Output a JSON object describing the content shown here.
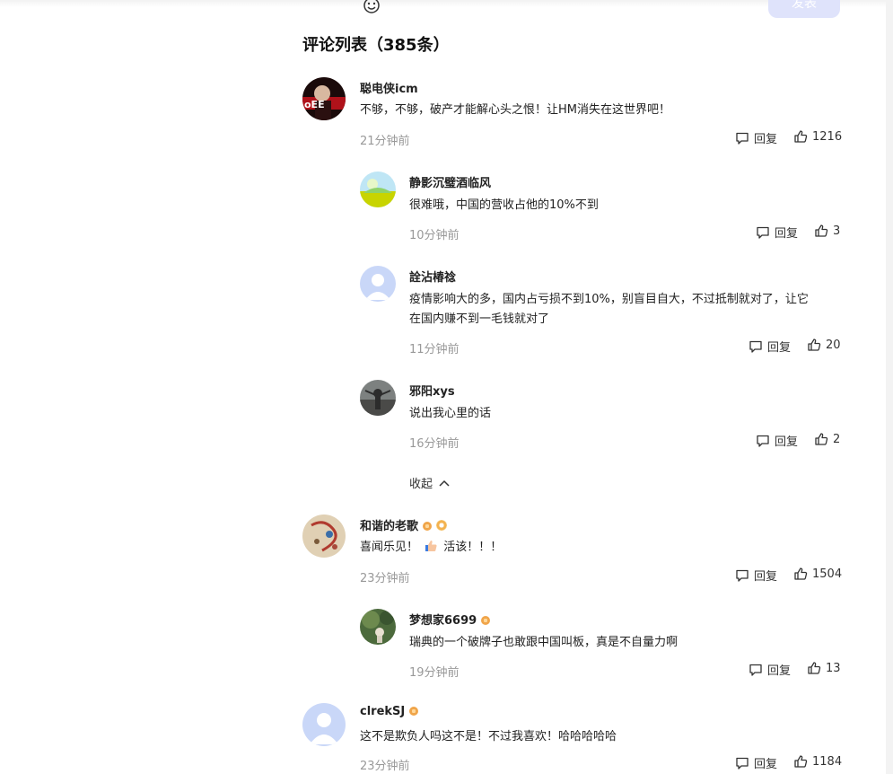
{
  "editor": {
    "submit_label": "发表",
    "emoji_icon": "smiley-icon"
  },
  "list": {
    "title": "评论列表（385条）"
  },
  "labels": {
    "reply": "回复",
    "collapse": "收起"
  },
  "comments": [
    {
      "user": "聪电侠icm",
      "text": "不够，不够，破产才能解心头之恨！让HM消失在这世界吧！",
      "time": "21分钟前",
      "likes": "1216"
    },
    {
      "user": "静影沉璧酒临风",
      "text": "很难哦，中国的营收占他的10%不到",
      "time": "10分钟前",
      "likes": "3"
    },
    {
      "user": "詮沾椿䄒",
      "text_line1": "疫情影响大的多，国内占亏损不到10%，别盲目自大，不过抵制就对了，让它",
      "text_line2": "在国内赚不到一毛钱就对了",
      "time": "11分钟前",
      "likes": "20"
    },
    {
      "user": "邪阳xys",
      "text": "说出我心里的话",
      "time": "16分钟前",
      "likes": "2"
    },
    {
      "user": "和谐的老歌",
      "text_a": "喜闻乐见！",
      "text_b": "活该！！！",
      "time": "23分钟前",
      "likes": "1504"
    },
    {
      "user": "梦想家6699",
      "text": "瑞典的一个破牌子也敢跟中国叫板，真是不自量力啊",
      "time": "19分钟前",
      "likes": "13"
    },
    {
      "user": "clrekSJ",
      "text": "这不是欺负人吗这不是！不过我喜欢！哈哈哈哈哈",
      "time": "23分钟前",
      "likes": "1184"
    }
  ],
  "colors": {
    "accent_disabled": "#dfe3fb",
    "muted": "#999999",
    "badge": "#f0a54a"
  }
}
